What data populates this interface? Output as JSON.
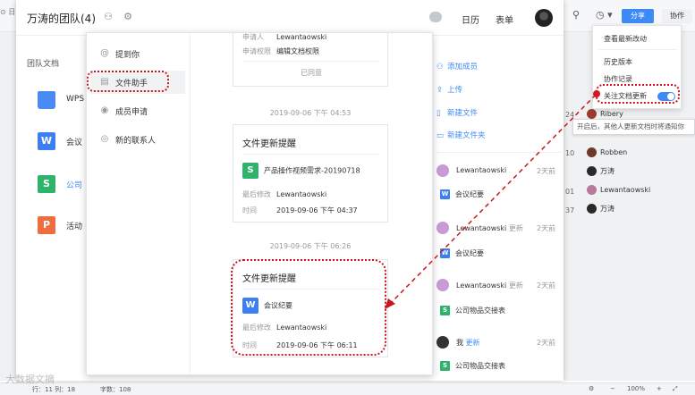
{
  "toolbar": {
    "left_fragment": "⊙ 日",
    "share_label": "分享",
    "collab_label": "协作"
  },
  "team": {
    "title": "万涛的团队(4)",
    "calendar_label": "日历",
    "form_label": "表单",
    "section_label": "团队文档",
    "files": [
      {
        "name": "WPS",
        "icon": "folder",
        "color": "#4a8af4"
      },
      {
        "name": "会议",
        "icon": "W",
        "color": "#3c7ff2"
      },
      {
        "name": "公司",
        "icon": "S",
        "color": "#2fb36b"
      },
      {
        "name": "活动",
        "icon": "P",
        "color": "#ef6c3c"
      }
    ],
    "actions": [
      {
        "label": "添加成员",
        "icon": "add-member-icon"
      },
      {
        "label": "上传",
        "icon": "upload-icon"
      },
      {
        "label": "新建文件",
        "icon": "new-file-icon"
      },
      {
        "label": "新建文件夹",
        "icon": "new-folder-icon"
      }
    ],
    "feed": [
      {
        "user": "Lewantaowski",
        "verb": "更新",
        "time": "2天前",
        "doc": "会议纪要",
        "doc_icon": "W",
        "doc_color": "#3c7ff2"
      },
      {
        "user": "Lewantaowski",
        "verb": "更新",
        "time": "2天前",
        "doc": "会议纪要",
        "doc_icon": "W",
        "doc_color": "#3c7ff2"
      },
      {
        "user": "Lewantaowski",
        "verb": "更新",
        "time": "2天前",
        "doc": "公司物品交接表",
        "doc_icon": "S",
        "doc_color": "#2fb36b"
      },
      {
        "user": "我",
        "verb": "更新",
        "time": "2天前",
        "doc": "公司物品交接表",
        "doc_icon": "S",
        "doc_color": "#2fb36b"
      }
    ]
  },
  "messages": {
    "nav": [
      {
        "label": "提到你",
        "icon": "at-icon"
      },
      {
        "label": "文件助手",
        "icon": "file-icon"
      },
      {
        "label": "成员申请",
        "icon": "user-icon"
      },
      {
        "label": "新的联系人",
        "icon": "contact-icon"
      }
    ],
    "top_card": {
      "applicant_key": "申请人",
      "applicant": "Lewantaowski",
      "permission_key": "申请权限",
      "permission": "编辑文档权限",
      "status": "已同意"
    },
    "timestamps": [
      "2019-09-06 下午 04:53",
      "2019-09-06 下午 06:26"
    ],
    "cards": [
      {
        "title": "文件更新提醒",
        "doc": "产品操作视频需求-20190718",
        "doc_icon": "S",
        "doc_color": "#2fb36b",
        "editor_key": "最后修改",
        "editor": "Lewantaowski",
        "time_key": "时间",
        "time": "2019-09-06 下午 04:37"
      },
      {
        "title": "文件更新提醒",
        "doc": "会议纪要",
        "doc_icon": "W",
        "doc_color": "#3c7ff2",
        "editor_key": "最后修改",
        "editor": "Lewantaowski",
        "time_key": "时间",
        "time": "2019-09-06 下午 06:11"
      }
    ]
  },
  "dropdown": {
    "items": [
      "查看最新改动",
      "历史版本",
      "协作记录",
      "关注文档更新"
    ],
    "toggle_on": true,
    "tooltip": "开启后，其他人更新文档时将通知你"
  },
  "members": {
    "rows": [
      {
        "num": "24",
        "name": "Ribery"
      },
      {
        "num": "",
        "name": ""
      },
      {
        "num": "10",
        "name": "Robben"
      },
      {
        "num": "",
        "name": "万涛"
      },
      {
        "num": "01",
        "name": "Lewantaowski"
      },
      {
        "num": "37",
        "name": "万涛"
      }
    ]
  },
  "statusbar": {
    "row_col": "行：11  列：18",
    "char_count": "字数：108",
    "zoom": "100%"
  },
  "watermark": "大数据文摘",
  "colors": {
    "accent": "#3d8af7",
    "annotation": "#c8161d"
  }
}
